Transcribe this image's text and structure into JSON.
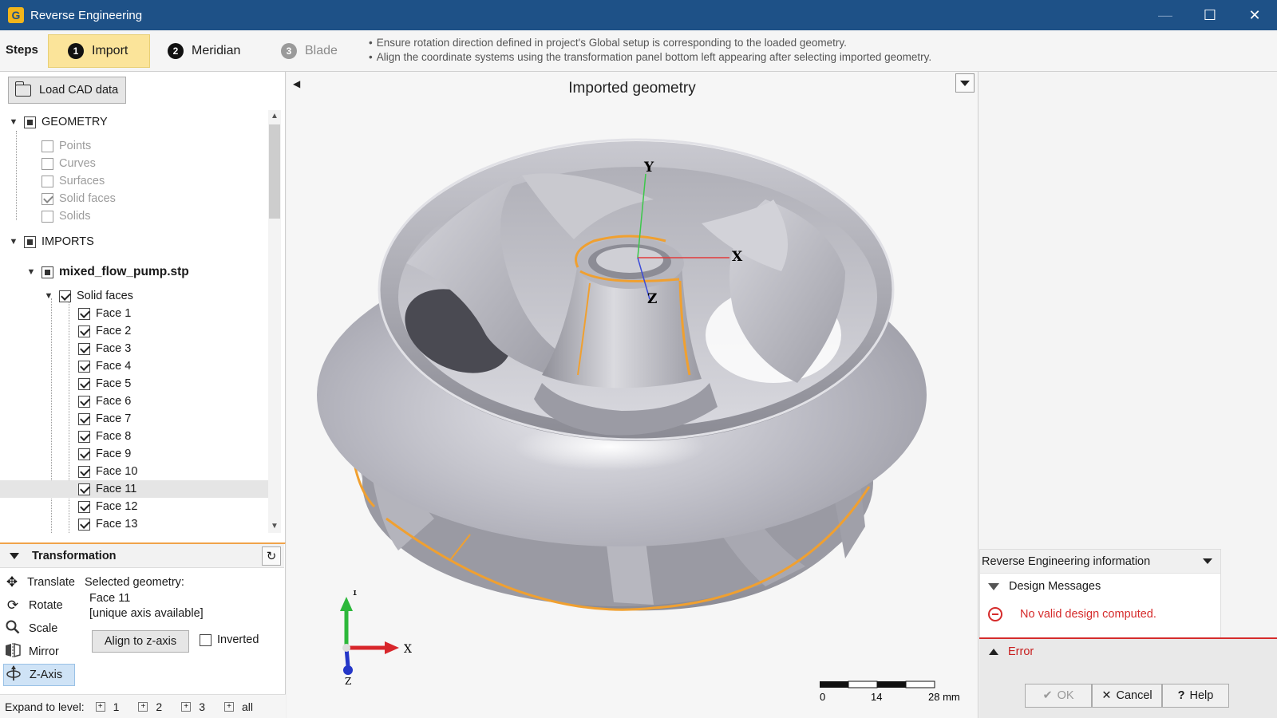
{
  "window": {
    "title": "Reverse Engineering",
    "logo": "G",
    "controls": [
      "—",
      "☐",
      "✕"
    ]
  },
  "steps": {
    "label": "Steps",
    "items": [
      {
        "num": "1",
        "label": "Import",
        "state": "active"
      },
      {
        "num": "2",
        "label": "Meridian",
        "state": "enabled"
      },
      {
        "num": "3",
        "label": "Blade",
        "state": "disabled"
      }
    ],
    "hints": [
      "Ensure rotation direction defined in project's Global setup is corresponding to the loaded geometry.",
      "Align the coordinate systems using the transformation panel bottom left appearing after selecting imported geometry."
    ]
  },
  "left_panel": {
    "load_button": "Load CAD data",
    "tree": {
      "geometry": {
        "label": "GEOMETRY",
        "children": [
          {
            "label": "Points",
            "checked": false
          },
          {
            "label": "Curves",
            "checked": false
          },
          {
            "label": "Surfaces",
            "checked": false
          },
          {
            "label": "Solid faces",
            "checked": true
          },
          {
            "label": "Solids",
            "checked": false
          }
        ]
      },
      "imports": {
        "label": "IMPORTS"
      },
      "file": {
        "label": "mixed_flow_pump.stp"
      },
      "solid_faces": {
        "label": "Solid faces"
      },
      "faces": [
        "Face 1",
        "Face 2",
        "Face 3",
        "Face 4",
        "Face 5",
        "Face 6",
        "Face 7",
        "Face 8",
        "Face 9",
        "Face 10",
        "Face 11",
        "Face 12",
        "Face 13"
      ],
      "selected_face": "Face 11"
    }
  },
  "transformation": {
    "title": "Transformation",
    "tools": [
      {
        "label": "Translate",
        "icon": "move-icon"
      },
      {
        "label": "Rotate",
        "icon": "rotate-icon"
      },
      {
        "label": "Scale",
        "icon": "magnifier-icon"
      },
      {
        "label": "Mirror",
        "icon": "mirror-icon"
      },
      {
        "label": "Z-Axis",
        "icon": "axis-icon"
      }
    ],
    "selected_label": "Selected geometry:",
    "selected_name": "Face 11",
    "selected_note": "[unique axis available]",
    "align_button": "Align to z-axis",
    "inverted_label": "Inverted"
  },
  "expand": {
    "label": "Expand to level:",
    "levels": [
      "1",
      "2",
      "3",
      "all"
    ]
  },
  "viewport": {
    "title": "Imported geometry",
    "model_axes": {
      "x": "X",
      "y": "Y",
      "z": "Z"
    },
    "triad_axes": {
      "x": "X",
      "y": "Y",
      "z": "Z"
    },
    "scale": {
      "ticks": [
        "0",
        "14",
        "28 mm"
      ]
    }
  },
  "right_panel": {
    "info_title": "Reverse Engineering information",
    "design_messages": "Design Messages",
    "error_message": "No valid design computed.",
    "error_section": "Error",
    "buttons": {
      "ok": "OK",
      "cancel": "Cancel",
      "help": "Help"
    }
  },
  "colors": {
    "titlebar": "#1e5187",
    "active_step": "#fbe49a",
    "highlight_edge": "#f0a030",
    "error": "#d52b2b"
  }
}
